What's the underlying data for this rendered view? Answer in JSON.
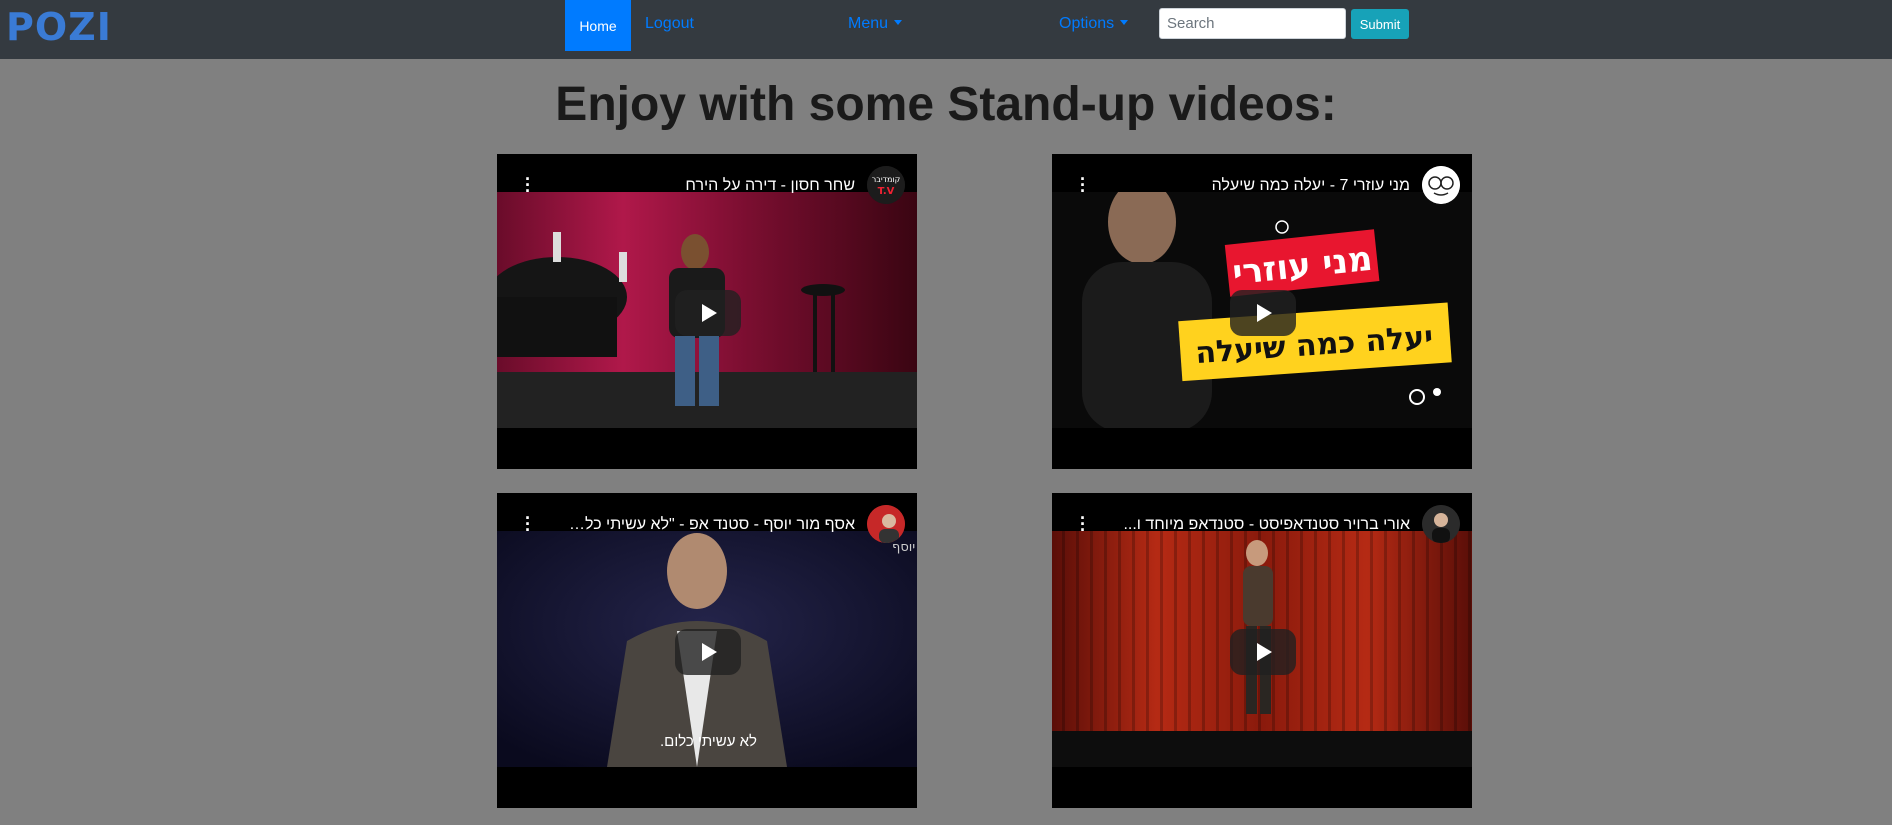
{
  "nav": {
    "brand": "POZI",
    "home": "Home",
    "logout": "Logout",
    "menu": "Menu",
    "options": "Options",
    "search_placeholder": "Search",
    "search_value": "",
    "submit": "Submit"
  },
  "heading": "Enjoy with some Stand-up videos:",
  "videos": [
    {
      "title": "שחר חסון - דירה על הירח",
      "channel_badge": "קומדיבר T.V",
      "overlay": ""
    },
    {
      "title": "מני עוזרי 7 - יעלה כמה שיעלה",
      "channel_badge": "",
      "overlay_line1": "מני עוזרי",
      "overlay_line2": "יעלה כמה שיעלה"
    },
    {
      "title": "אסף מור יוסף - סטנד אפ - \"לא עשיתי כלום\"",
      "overlay_top": "אסף מור יוסף",
      "overlay_sub": "לא עשיתי כלום."
    },
    {
      "title": "אורי ברויר סטנדאפיסט - סטנדאפ מיוחד ו..."
    }
  ],
  "colors": {
    "navbar": "#343a40",
    "page_bg": "#808080",
    "primary": "#007bff",
    "submit": "#17a2b8"
  }
}
